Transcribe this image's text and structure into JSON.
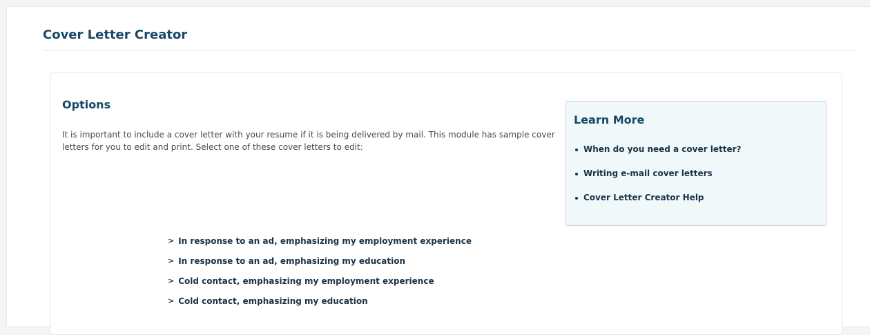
{
  "page": {
    "title": "Cover Letter Creator"
  },
  "options": {
    "heading": "Options",
    "intro": "It is important to include a cover letter with your resume if it is being delivered by mail. This module has sample cover letters for you to edit and print. Select one of these cover letters to edit:",
    "letters": [
      {
        "label": "In response to an ad, emphasizing my employment experience",
        "icon": "chevron-right-icon"
      },
      {
        "label": "In response to an ad, emphasizing my education",
        "icon": "chevron-right-icon"
      },
      {
        "label": "Cold contact, emphasizing my employment experience",
        "icon": "chevron-right-icon"
      },
      {
        "label": "Cold contact, emphasizing my education",
        "icon": "chevron-right-icon"
      }
    ]
  },
  "learn_more": {
    "heading": "Learn More",
    "links": [
      {
        "label": "When do you need a cover letter?"
      },
      {
        "label": "Writing e-mail cover letters"
      },
      {
        "label": "Cover Letter Creator Help"
      }
    ]
  },
  "colors": {
    "heading": "#174a67",
    "link": "#1a3347",
    "learn_bg": "#f0f8fa",
    "learn_border": "#c6d3da"
  }
}
